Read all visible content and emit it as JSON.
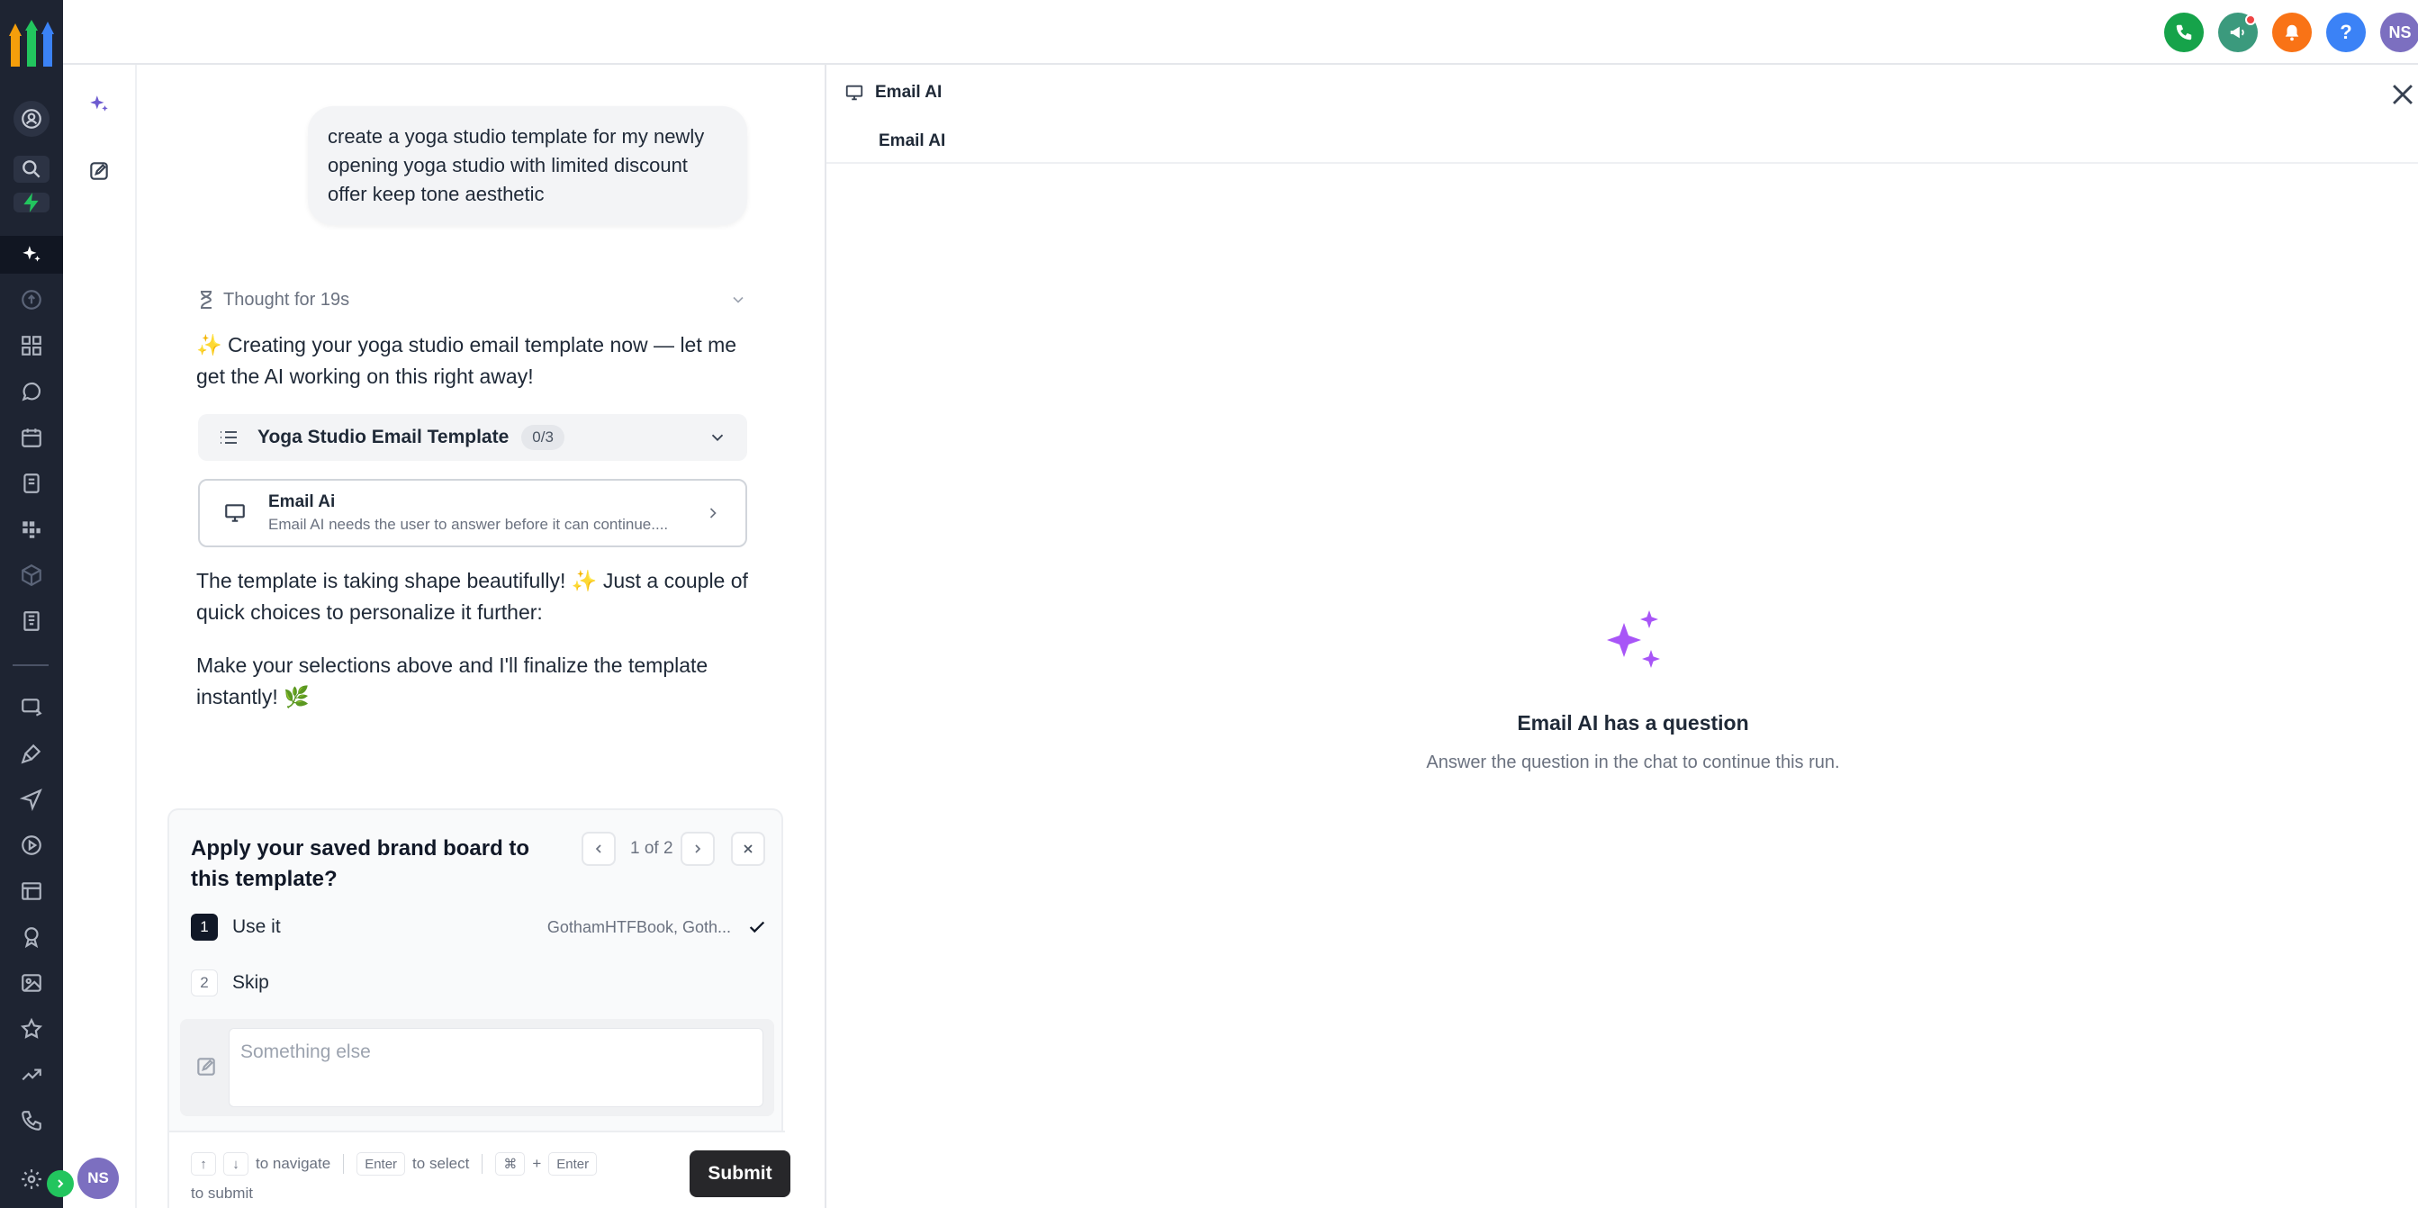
{
  "topbar": {
    "user_initials": "NS",
    "help_label": "?"
  },
  "sidebar": {
    "user_initials": "NS"
  },
  "chat": {
    "user_message": "create a yoga studio template for my newly opening yoga studio with limited discount offer keep tone aesthetic",
    "thought_label": "Thought for 19s",
    "response_intro": "✨ Creating your yoga studio email template now — let me get the AI working on this right away!",
    "plan": {
      "title": "Yoga Studio Email Template",
      "progress": "0/3"
    },
    "agent_card": {
      "name": "Email Ai",
      "description": "Email AI needs the user to answer before it can continue...."
    },
    "response_shape": "The template is taking shape beautifully! ✨ Just a couple of quick choices to personalize it further:",
    "response_final": "Make your selections above and I'll finalize the template instantly! 🌿"
  },
  "question": {
    "title": "Apply your saved brand board to this template?",
    "counter": "1 of 2",
    "options": [
      {
        "number": "1",
        "label": "Use it",
        "detail": "GothamHTFBook, Goth...",
        "selected": true
      },
      {
        "number": "2",
        "label": "Skip",
        "detail": "",
        "selected": false
      }
    ],
    "input_placeholder": "Something else",
    "hints": {
      "navigate": "to navigate",
      "enter_key": "Enter",
      "select": "to select",
      "cmd_key": "⌘",
      "plus": "+",
      "enter_key2": "Enter",
      "submit_hint": "to submit"
    },
    "submit_label": "Submit"
  },
  "panel": {
    "header": "Email AI",
    "tab": "Email AI",
    "empty_title": "Email AI has a question",
    "empty_subtitle": "Answer the question in the chat to continue this run."
  },
  "colors": {
    "rail_bg": "#1e2432",
    "accent_purple": "#a855f7",
    "phone_green": "#16a34a",
    "megaphone_teal": "#3b9a7d",
    "bell_orange": "#f97316",
    "help_blue": "#3b82f6",
    "avatar_purple": "#7c6fc0"
  },
  "icons": [
    "app-logo",
    "contacts-icon",
    "search-icon",
    "bolt-icon",
    "ai-sparkle-icon",
    "launchpad-icon",
    "dashboard-icon",
    "conversations-icon",
    "calendar-icon",
    "contacts-book-icon",
    "opportunities-icon",
    "payments-icon",
    "marketing-icon",
    "automation-icon",
    "sites-icon",
    "memberships-icon",
    "media-icon",
    "reputation-icon",
    "reporting-icon",
    "app-marketplace-icon",
    "phone-icon",
    "settings-icon",
    "megaphone-icon",
    "bell-icon",
    "help-icon",
    "pencil-edit-icon",
    "hourglass-icon",
    "chevron-down-icon",
    "list-icon",
    "monitor-icon",
    "chevron-right-icon",
    "chevron-left-icon",
    "close-icon",
    "check-icon",
    "sparkle-icon"
  ]
}
